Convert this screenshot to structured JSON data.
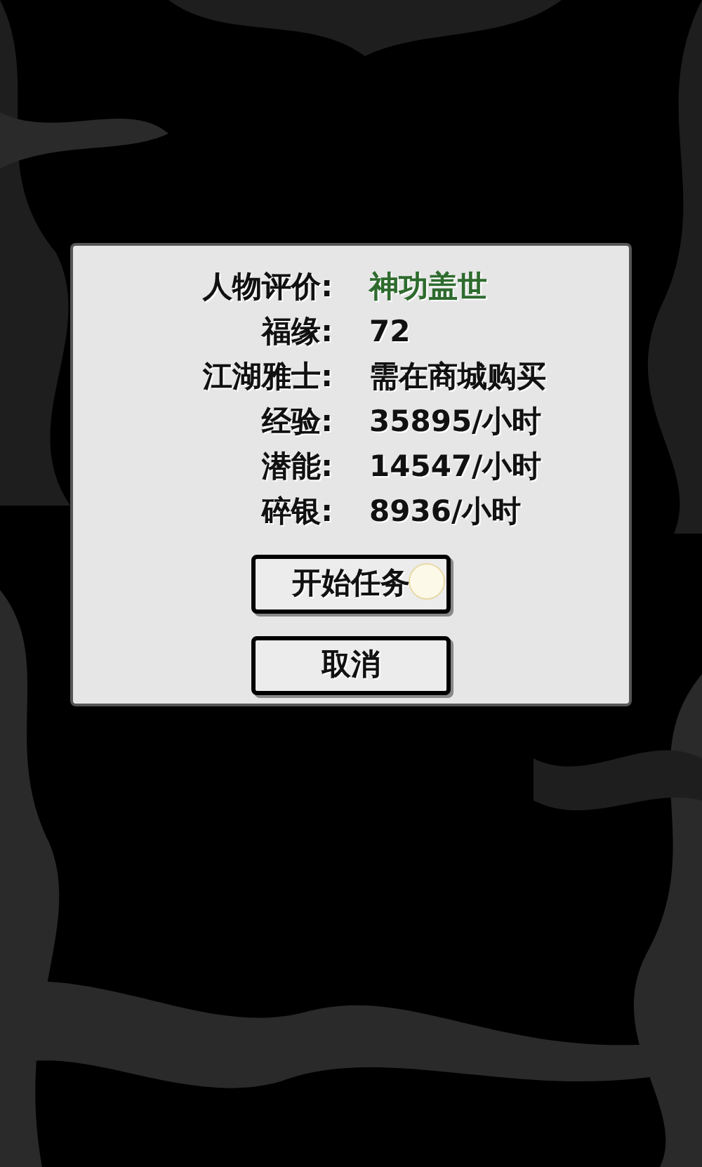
{
  "dialog": {
    "rows": [
      {
        "label": "人物评价:",
        "value": "神功盖世",
        "color": "#2e6b2e"
      },
      {
        "label": "福缘:",
        "value": "72",
        "color": "#111111"
      },
      {
        "label": "江湖雅士:",
        "value": "需在商城购买",
        "color": "#111111"
      },
      {
        "label": "经验:",
        "value": "35895/小时",
        "color": "#111111"
      },
      {
        "label": "潜能:",
        "value": "14547/小时",
        "color": "#111111"
      },
      {
        "label": "碎银:",
        "value": "8936/小时",
        "color": "#111111"
      }
    ],
    "buttons": [
      {
        "label": "开始任务",
        "pressed": true
      },
      {
        "label": "取消",
        "pressed": false
      }
    ]
  }
}
